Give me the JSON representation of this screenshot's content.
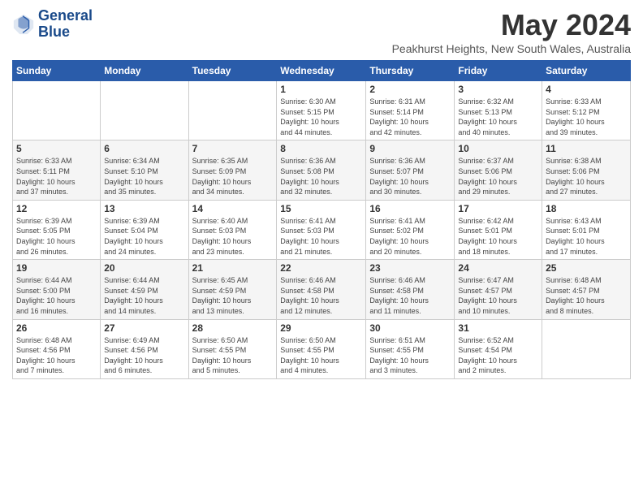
{
  "header": {
    "logo_line1": "General",
    "logo_line2": "Blue",
    "month": "May 2024",
    "location": "Peakhurst Heights, New South Wales, Australia"
  },
  "weekdays": [
    "Sunday",
    "Monday",
    "Tuesday",
    "Wednesday",
    "Thursday",
    "Friday",
    "Saturday"
  ],
  "weeks": [
    [
      {
        "day": "",
        "info": ""
      },
      {
        "day": "",
        "info": ""
      },
      {
        "day": "",
        "info": ""
      },
      {
        "day": "1",
        "info": "Sunrise: 6:30 AM\nSunset: 5:15 PM\nDaylight: 10 hours\nand 44 minutes."
      },
      {
        "day": "2",
        "info": "Sunrise: 6:31 AM\nSunset: 5:14 PM\nDaylight: 10 hours\nand 42 minutes."
      },
      {
        "day": "3",
        "info": "Sunrise: 6:32 AM\nSunset: 5:13 PM\nDaylight: 10 hours\nand 40 minutes."
      },
      {
        "day": "4",
        "info": "Sunrise: 6:33 AM\nSunset: 5:12 PM\nDaylight: 10 hours\nand 39 minutes."
      }
    ],
    [
      {
        "day": "5",
        "info": "Sunrise: 6:33 AM\nSunset: 5:11 PM\nDaylight: 10 hours\nand 37 minutes."
      },
      {
        "day": "6",
        "info": "Sunrise: 6:34 AM\nSunset: 5:10 PM\nDaylight: 10 hours\nand 35 minutes."
      },
      {
        "day": "7",
        "info": "Sunrise: 6:35 AM\nSunset: 5:09 PM\nDaylight: 10 hours\nand 34 minutes."
      },
      {
        "day": "8",
        "info": "Sunrise: 6:36 AM\nSunset: 5:08 PM\nDaylight: 10 hours\nand 32 minutes."
      },
      {
        "day": "9",
        "info": "Sunrise: 6:36 AM\nSunset: 5:07 PM\nDaylight: 10 hours\nand 30 minutes."
      },
      {
        "day": "10",
        "info": "Sunrise: 6:37 AM\nSunset: 5:06 PM\nDaylight: 10 hours\nand 29 minutes."
      },
      {
        "day": "11",
        "info": "Sunrise: 6:38 AM\nSunset: 5:06 PM\nDaylight: 10 hours\nand 27 minutes."
      }
    ],
    [
      {
        "day": "12",
        "info": "Sunrise: 6:39 AM\nSunset: 5:05 PM\nDaylight: 10 hours\nand 26 minutes."
      },
      {
        "day": "13",
        "info": "Sunrise: 6:39 AM\nSunset: 5:04 PM\nDaylight: 10 hours\nand 24 minutes."
      },
      {
        "day": "14",
        "info": "Sunrise: 6:40 AM\nSunset: 5:03 PM\nDaylight: 10 hours\nand 23 minutes."
      },
      {
        "day": "15",
        "info": "Sunrise: 6:41 AM\nSunset: 5:03 PM\nDaylight: 10 hours\nand 21 minutes."
      },
      {
        "day": "16",
        "info": "Sunrise: 6:41 AM\nSunset: 5:02 PM\nDaylight: 10 hours\nand 20 minutes."
      },
      {
        "day": "17",
        "info": "Sunrise: 6:42 AM\nSunset: 5:01 PM\nDaylight: 10 hours\nand 18 minutes."
      },
      {
        "day": "18",
        "info": "Sunrise: 6:43 AM\nSunset: 5:01 PM\nDaylight: 10 hours\nand 17 minutes."
      }
    ],
    [
      {
        "day": "19",
        "info": "Sunrise: 6:44 AM\nSunset: 5:00 PM\nDaylight: 10 hours\nand 16 minutes."
      },
      {
        "day": "20",
        "info": "Sunrise: 6:44 AM\nSunset: 4:59 PM\nDaylight: 10 hours\nand 14 minutes."
      },
      {
        "day": "21",
        "info": "Sunrise: 6:45 AM\nSunset: 4:59 PM\nDaylight: 10 hours\nand 13 minutes."
      },
      {
        "day": "22",
        "info": "Sunrise: 6:46 AM\nSunset: 4:58 PM\nDaylight: 10 hours\nand 12 minutes."
      },
      {
        "day": "23",
        "info": "Sunrise: 6:46 AM\nSunset: 4:58 PM\nDaylight: 10 hours\nand 11 minutes."
      },
      {
        "day": "24",
        "info": "Sunrise: 6:47 AM\nSunset: 4:57 PM\nDaylight: 10 hours\nand 10 minutes."
      },
      {
        "day": "25",
        "info": "Sunrise: 6:48 AM\nSunset: 4:57 PM\nDaylight: 10 hours\nand 8 minutes."
      }
    ],
    [
      {
        "day": "26",
        "info": "Sunrise: 6:48 AM\nSunset: 4:56 PM\nDaylight: 10 hours\nand 7 minutes."
      },
      {
        "day": "27",
        "info": "Sunrise: 6:49 AM\nSunset: 4:56 PM\nDaylight: 10 hours\nand 6 minutes."
      },
      {
        "day": "28",
        "info": "Sunrise: 6:50 AM\nSunset: 4:55 PM\nDaylight: 10 hours\nand 5 minutes."
      },
      {
        "day": "29",
        "info": "Sunrise: 6:50 AM\nSunset: 4:55 PM\nDaylight: 10 hours\nand 4 minutes."
      },
      {
        "day": "30",
        "info": "Sunrise: 6:51 AM\nSunset: 4:55 PM\nDaylight: 10 hours\nand 3 minutes."
      },
      {
        "day": "31",
        "info": "Sunrise: 6:52 AM\nSunset: 4:54 PM\nDaylight: 10 hours\nand 2 minutes."
      },
      {
        "day": "",
        "info": ""
      }
    ]
  ]
}
